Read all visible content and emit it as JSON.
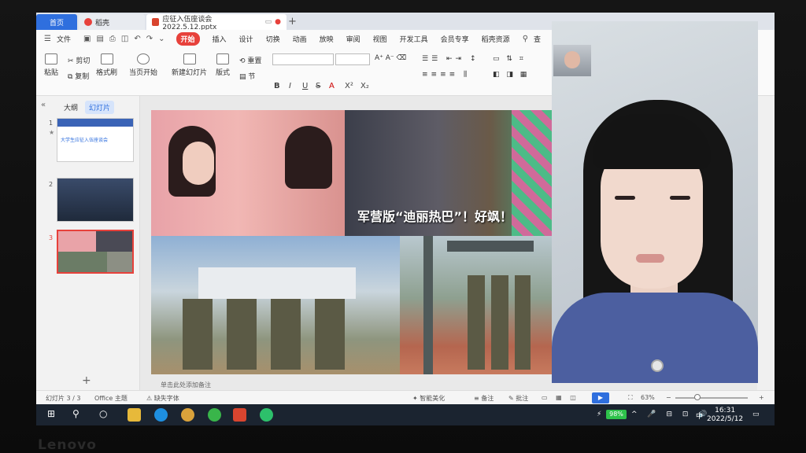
{
  "tabs": [
    {
      "label": "首页"
    },
    {
      "label": "稻壳"
    },
    {
      "label": "应征入伍座谈会2022.5.12.pptx"
    }
  ],
  "menu": {
    "file": "文件",
    "items": [
      "开始",
      "插入",
      "设计",
      "切换",
      "动画",
      "放映",
      "审阅",
      "视图",
      "开发工具",
      "会员专享",
      "稻壳资源"
    ],
    "active": "开始",
    "search": "查"
  },
  "ribbon": {
    "paste": "粘贴",
    "cut": "剪切",
    "copy": "复制",
    "format_painter": "格式刷",
    "play_from_current": "当页开始",
    "new_slide": "新建幻灯片",
    "layout": "版式",
    "section": "节",
    "reset": "重置",
    "font_buttons": [
      "B",
      "I",
      "U",
      "S",
      "A",
      "X²",
      "X₂"
    ]
  },
  "left_panel": {
    "outline_tab": "大纲",
    "slides_tab": "幻灯片",
    "thumbnails": [
      {
        "number": "1",
        "title": "大学生应征入伍座谈会"
      },
      {
        "number": "2",
        "title": ""
      },
      {
        "number": "3",
        "title": ""
      }
    ],
    "add": "+"
  },
  "slide": {
    "caption": "军营版“迪丽热巴”！好飒！"
  },
  "notes": {
    "placeholder": "单击此处添加备注"
  },
  "status": {
    "slide_counter": "幻灯片 3 / 3",
    "theme": "Office 主题",
    "missing_font": "缺失字体",
    "smart_beautify": "智能美化",
    "notes": "备注",
    "comments": "批注",
    "zoom": "63%"
  },
  "taskbar": {
    "battery": "98%",
    "ime": "中",
    "time": "16:31",
    "date": "2022/5/12"
  },
  "brand": "Lenovo",
  "colors": {
    "accent": "#2f6fde",
    "active_menu": "#e7413b",
    "battery": "#2ec24b",
    "taskbar": "#1b2430"
  }
}
